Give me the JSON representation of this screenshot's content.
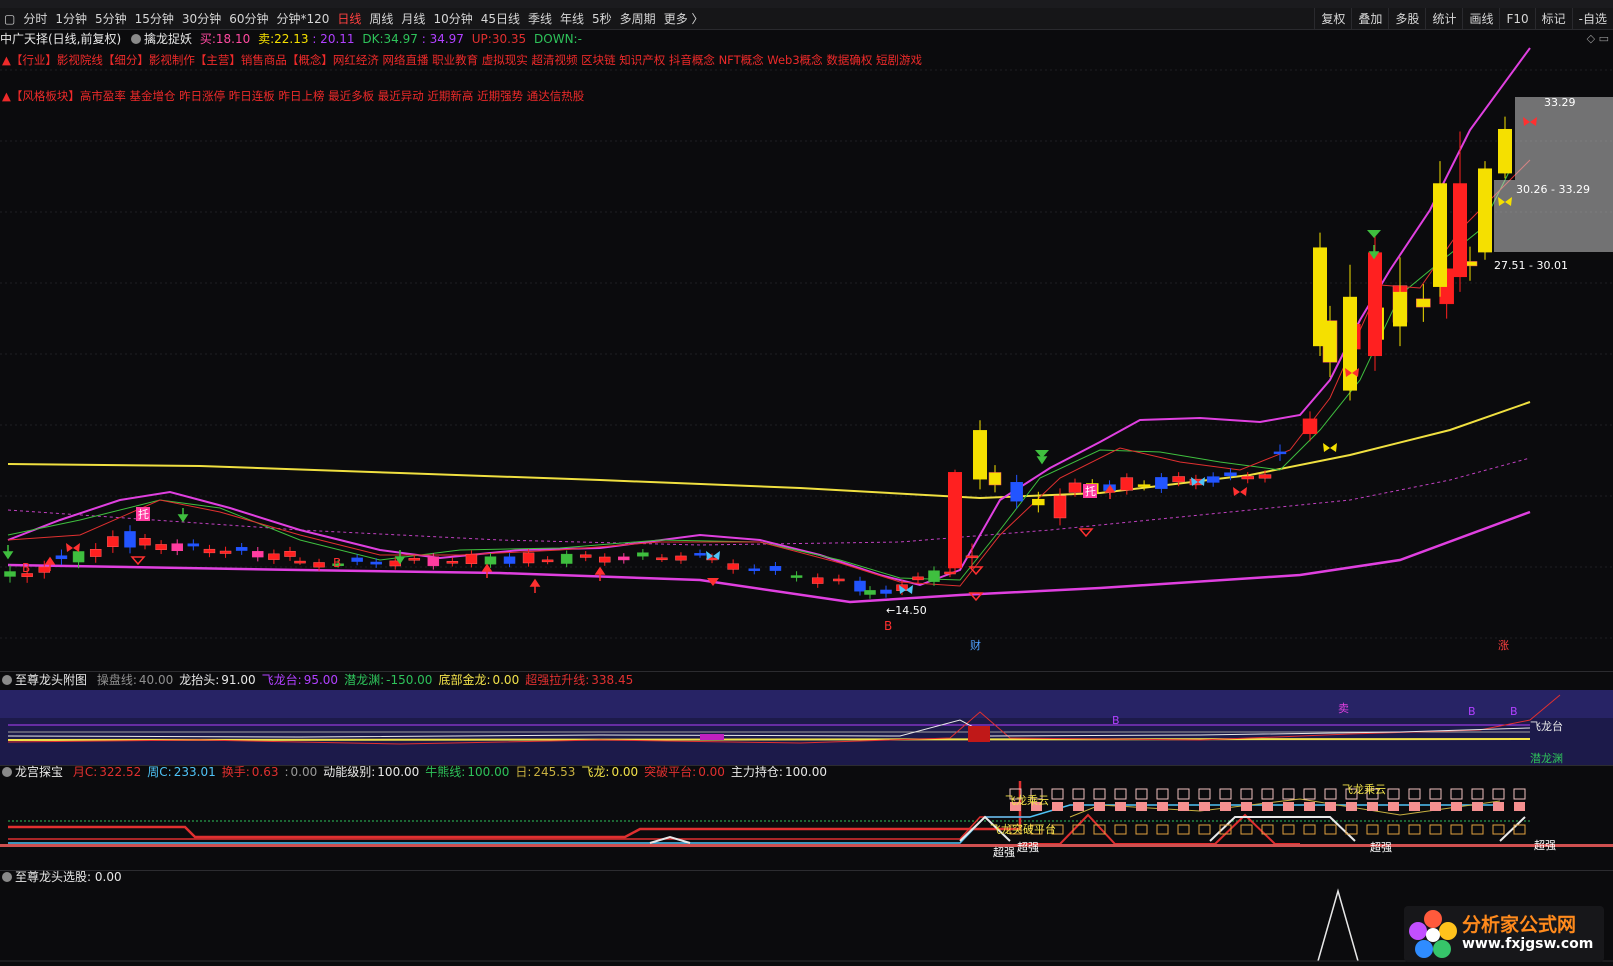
{
  "toolbar": {
    "periods": [
      "分时",
      "1分钟",
      "5分钟",
      "15分钟",
      "30分钟",
      "60分钟",
      "分钟*120",
      "日线",
      "周线",
      "月线",
      "10分钟",
      "45日线",
      "季线",
      "年线",
      "5秒",
      "多周期",
      "更多 〉"
    ],
    "active_period": "日线",
    "right_tools": [
      "复权",
      "叠加",
      "多股",
      "统计",
      "画线",
      "F10",
      "标记",
      "-自选"
    ]
  },
  "info": {
    "stock": "中广天择(日线,前复权)",
    "indicator": "擒龙捉妖",
    "buy_label": "买:",
    "buy_value": "18.10",
    "sell_label": "卖:",
    "sell_value": "22.13",
    "mid_value": ": 20.11",
    "dk_label": "DK:",
    "dk_value": "34.97",
    "dk2_value": ": 34.97",
    "up_label": "UP:",
    "up_value": "30.35",
    "down_label": "DOWN:",
    "down_value": "-"
  },
  "sectors": "▲【行业】影视院线【细分】影视制作【主营】销售商品【概念】网红经济 网络直播 职业教育 虚拟现实 超清视频 区块链 知识产权 抖音概念 NFT概念 Web3概念 数据确权 短剧游戏",
  "styles": "▲【风格板块】高市盈率 基金增仓 昨日涨停 昨日连板 昨日上榜 最近多板 最近异动 近期新高 近期强势 通达信热股",
  "annotations": {
    "price_box1": "33.29",
    "price_box2": "30.26 - 33.29",
    "price_box3": "27.51 - 30.01",
    "low_price": "←14.50",
    "marker_cai": "财",
    "marker_zhang": "涨",
    "marker_b": "B",
    "marker_tuo": "托"
  },
  "pane2": {
    "title": "至尊龙头附图",
    "items": [
      {
        "label": "操盘线:",
        "value": "40.00",
        "color": "#8f8f8f"
      },
      {
        "label": "龙抬头:",
        "value": "91.00",
        "color": "#e8e8e8"
      },
      {
        "label": "飞龙台:",
        "value": "95.00",
        "color": "#b040ff"
      },
      {
        "label": "潜龙渊:",
        "value": "-150.00",
        "color": "#2ec25a"
      },
      {
        "label": "底部金龙:",
        "value": "0.00",
        "color": "#f2e24a"
      },
      {
        "label": "超强拉升线:",
        "value": "338.45",
        "color": "#e03030"
      }
    ],
    "right_label_top": "飞龙台",
    "right_label_bottom": "潜龙渊",
    "marker_sell": "卖",
    "marker_b": "B"
  },
  "pane3": {
    "title": "龙宫探宝",
    "items": [
      {
        "label": "月C:",
        "value": "322.52",
        "color": "#e03030"
      },
      {
        "label": "周C:",
        "value": "233.01",
        "color": "#4fc3f7"
      },
      {
        "label": "换手:",
        "value": "0.63",
        "color": "#e03030"
      },
      {
        "label": ":",
        "value": "0.00",
        "color": "#9a9a9a"
      },
      {
        "label": "动能级别:",
        "value": "100.00",
        "color": "#e8e8e8"
      },
      {
        "label": "牛熊线:",
        "value": "100.00",
        "color": "#2ec25a"
      },
      {
        "label": "日:",
        "value": "245.53",
        "color": "#c8b040"
      },
      {
        "label": "飞龙:",
        "value": "0.00",
        "color": "#f2e24a"
      },
      {
        "label": "突破平台:",
        "value": "0.00",
        "color": "#e03030"
      },
      {
        "label": "主力持仓:",
        "value": "100.00",
        "color": "#e8e8e8"
      }
    ],
    "tag_feilong": "飞龙乘云",
    "tag_platform": "飞龙突破平台",
    "tag_super": "超强"
  },
  "pane4": {
    "title": "至尊龙头选股",
    "value": ": 0.00"
  },
  "logo": {
    "name": "分析家公式网",
    "url": "www.fxjgsw.com"
  },
  "colors": {
    "up": "#ff2020",
    "down": "#2255ff",
    "yellow": "#f5e000",
    "magenta": "#e040e0",
    "green": "#3fbf3f"
  }
}
